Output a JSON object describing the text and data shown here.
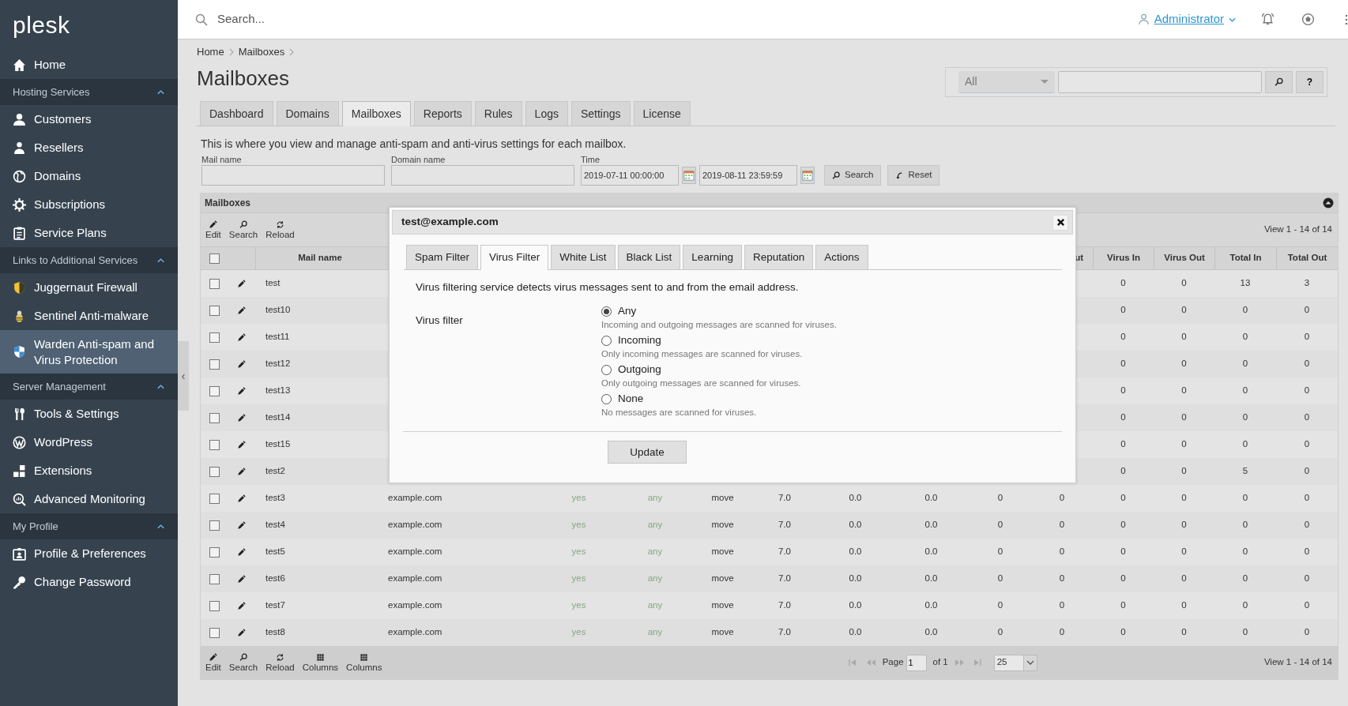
{
  "sidebar": {
    "logo": "plesk",
    "home": {
      "label": "Home",
      "selected": false
    },
    "groups": [
      {
        "title": "Hosting Services",
        "expanded": true,
        "items": [
          {
            "label": "Customers",
            "selected": false
          },
          {
            "label": "Resellers",
            "selected": false
          },
          {
            "label": "Domains",
            "selected": false
          },
          {
            "label": "Subscriptions",
            "selected": false
          },
          {
            "label": "Service Plans",
            "selected": false
          }
        ]
      },
      {
        "title": "Links to Additional Services",
        "expanded": true,
        "items": [
          {
            "label": "Juggernaut Firewall",
            "selected": false
          },
          {
            "label": "Sentinel Anti-malware",
            "selected": false
          },
          {
            "label": "Warden Anti-spam and Virus Protection",
            "selected": true
          }
        ]
      },
      {
        "title": "Server Management",
        "expanded": true,
        "items": [
          {
            "label": "Tools & Settings",
            "selected": false
          },
          {
            "label": "WordPress",
            "selected": false
          },
          {
            "label": "Extensions",
            "selected": false
          },
          {
            "label": "Advanced Monitoring",
            "selected": false
          }
        ]
      },
      {
        "title": "My Profile",
        "expanded": true,
        "items": [
          {
            "label": "Profile & Preferences",
            "selected": false
          },
          {
            "label": "Change Password",
            "selected": false
          }
        ]
      }
    ]
  },
  "sidebar_toggle": "‹",
  "topbar": {
    "search": {
      "placeholder": "Search..."
    },
    "user": "Administrator"
  },
  "breadcrumb": [
    "Home",
    "Mailboxes"
  ],
  "title": "Mailboxes",
  "quick_search": {
    "scope": "All",
    "help": "?"
  },
  "tabs": [
    {
      "label": "Dashboard",
      "selected": false
    },
    {
      "label": "Domains",
      "selected": false
    },
    {
      "label": "Mailboxes",
      "selected": true
    },
    {
      "label": "Reports",
      "selected": false
    },
    {
      "label": "Rules",
      "selected": false
    },
    {
      "label": "Logs",
      "selected": false
    },
    {
      "label": "Settings",
      "selected": false
    },
    {
      "label": "License",
      "selected": false
    }
  ],
  "description": "This is where you view and manage anti-spam and anti-virus settings for each mailbox.",
  "filters": {
    "mail_name": {
      "label": "Mail name"
    },
    "domain_name": {
      "label": "Domain name"
    },
    "time": {
      "label": "Time",
      "from": "2019-07-11 00:00:00",
      "to": "2019-08-11 23:59:59"
    },
    "buttons": [
      "Search",
      "Reset"
    ]
  },
  "grid": {
    "title": "Mailboxes",
    "expanded": true,
    "toolbar": [
      "Edit",
      "Search",
      "Reload"
    ],
    "summary": "View 1 - 14 of 14",
    "all_checked": false,
    "columns": [
      {
        "label": "Mail name"
      },
      {},
      {},
      {},
      {},
      {},
      {},
      {},
      {},
      {
        "label": "ut"
      },
      {
        "label": "Virus In"
      },
      {
        "label": "Virus Out"
      },
      {
        "label": "Total In"
      },
      {
        "label": "Total Out"
      }
    ],
    "rows": [
      {
        "checked": false,
        "cells": [
          "test",
          "",
          "",
          "",
          "",
          "",
          "",
          "",
          "",
          "",
          "0",
          "0",
          "13",
          "3"
        ]
      },
      {
        "checked": false,
        "cells": [
          "test10",
          "",
          "",
          "",
          "",
          "",
          "",
          "",
          "",
          "",
          "0",
          "0",
          "0",
          "0"
        ]
      },
      {
        "checked": false,
        "cells": [
          "test11",
          "",
          "",
          "",
          "",
          "",
          "",
          "",
          "",
          "",
          "0",
          "0",
          "0",
          "0"
        ]
      },
      {
        "checked": false,
        "cells": [
          "test12",
          "",
          "",
          "",
          "",
          "",
          "",
          "",
          "",
          "",
          "0",
          "0",
          "0",
          "0"
        ]
      },
      {
        "checked": false,
        "cells": [
          "test13",
          "",
          "",
          "",
          "",
          "",
          "",
          "",
          "",
          "",
          "0",
          "0",
          "0",
          "0"
        ]
      },
      {
        "checked": false,
        "cells": [
          "test14",
          "",
          "",
          "",
          "",
          "",
          "",
          "",
          "",
          "",
          "0",
          "0",
          "0",
          "0"
        ]
      },
      {
        "checked": false,
        "cells": [
          "test15",
          "",
          "",
          "",
          "",
          "",
          "",
          "",
          "",
          "",
          "0",
          "0",
          "0",
          "0"
        ]
      },
      {
        "checked": false,
        "cells": [
          "test2",
          "",
          "",
          "",
          "",
          "",
          "",
          "",
          "",
          "",
          "0",
          "0",
          "5",
          "0"
        ]
      },
      {
        "checked": false,
        "cells": [
          "test3",
          "example.com",
          "yes",
          "any",
          "move",
          "7.0",
          "0.0",
          "0.0",
          "0",
          "0",
          "0",
          "0",
          "0",
          "0"
        ]
      },
      {
        "checked": false,
        "cells": [
          "test4",
          "example.com",
          "yes",
          "any",
          "move",
          "7.0",
          "0.0",
          "0.0",
          "0",
          "0",
          "0",
          "0",
          "0",
          "0"
        ]
      },
      {
        "checked": false,
        "cells": [
          "test5",
          "example.com",
          "yes",
          "any",
          "move",
          "7.0",
          "0.0",
          "0.0",
          "0",
          "0",
          "0",
          "0",
          "0",
          "0"
        ]
      },
      {
        "checked": false,
        "cells": [
          "test6",
          "example.com",
          "yes",
          "any",
          "move",
          "7.0",
          "0.0",
          "0.0",
          "0",
          "0",
          "0",
          "0",
          "0",
          "0"
        ]
      },
      {
        "checked": false,
        "cells": [
          "test7",
          "example.com",
          "yes",
          "any",
          "move",
          "7.0",
          "0.0",
          "0.0",
          "0",
          "0",
          "0",
          "0",
          "0",
          "0"
        ]
      },
      {
        "checked": false,
        "cells": [
          "test8",
          "example.com",
          "yes",
          "any",
          "move",
          "7.0",
          "0.0",
          "0.0",
          "0",
          "0",
          "0",
          "0",
          "0",
          "0"
        ]
      }
    ],
    "footer_toolbar": [
      "Edit",
      "Search",
      "Reload",
      "Columns",
      "Columns"
    ],
    "pager": {
      "nav_disabled": true,
      "page_label": "Page",
      "page": "1",
      "of": "of 1",
      "page_size": "25"
    },
    "footer_summary": "View 1 - 14 of 14"
  },
  "dialog": {
    "title": "test@example.com",
    "tabs": [
      {
        "label": "Spam Filter",
        "selected": false
      },
      {
        "label": "Virus Filter",
        "selected": true
      },
      {
        "label": "White List",
        "selected": false
      },
      {
        "label": "Black List",
        "selected": false
      },
      {
        "label": "Learning",
        "selected": false
      },
      {
        "label": "Reputation",
        "selected": false
      },
      {
        "label": "Actions",
        "selected": false
      }
    ],
    "description": "Virus filtering service detects virus messages sent to and from the email address.",
    "field_label": "Virus filter",
    "options": [
      {
        "label": "Any",
        "hint": "Incoming and outgoing messages are scanned for viruses.",
        "selected": true
      },
      {
        "label": "Incoming",
        "hint": "Only incoming messages are scanned for viruses.",
        "selected": false
      },
      {
        "label": "Outgoing",
        "hint": "Only outgoing messages are scanned for viruses.",
        "selected": false
      },
      {
        "label": "None",
        "hint": "No messages are scanned for viruses.",
        "selected": false
      }
    ],
    "button": "Update"
  }
}
